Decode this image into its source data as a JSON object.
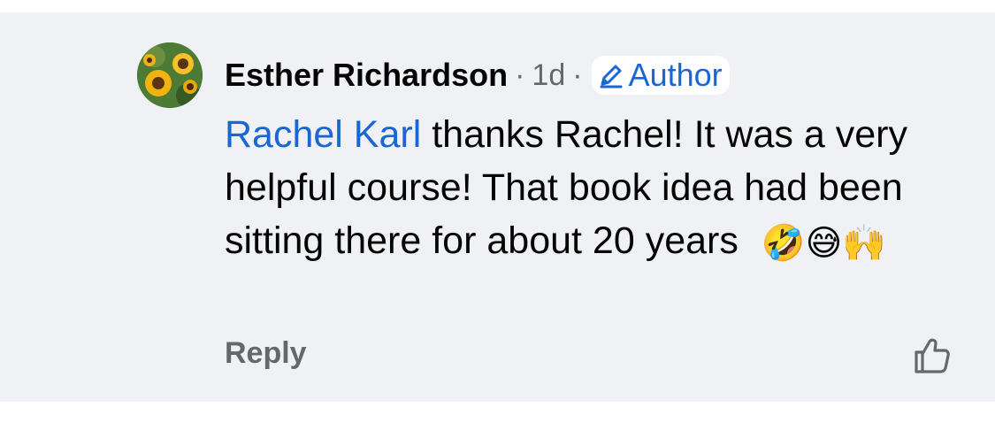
{
  "comment": {
    "author": "Esther Richardson",
    "time": "1d",
    "separator": "·",
    "badge_label": "Author",
    "mention": "Rachel Karl",
    "body_text": " thanks Rachel! It was a very helpful course! That book idea had been sitting there for about 20 years",
    "emojis": [
      "🤣",
      "😅",
      "🙌"
    ]
  },
  "actions": {
    "reply_label": "Reply"
  },
  "icons": {
    "avatar": "sunflower-avatar",
    "badge": "pencil-icon",
    "like": "thumbs-up-icon"
  },
  "colors": {
    "comment_background": "#f0f1f5",
    "link_blue": "#1a66d2",
    "secondary_text": "#65676b"
  }
}
